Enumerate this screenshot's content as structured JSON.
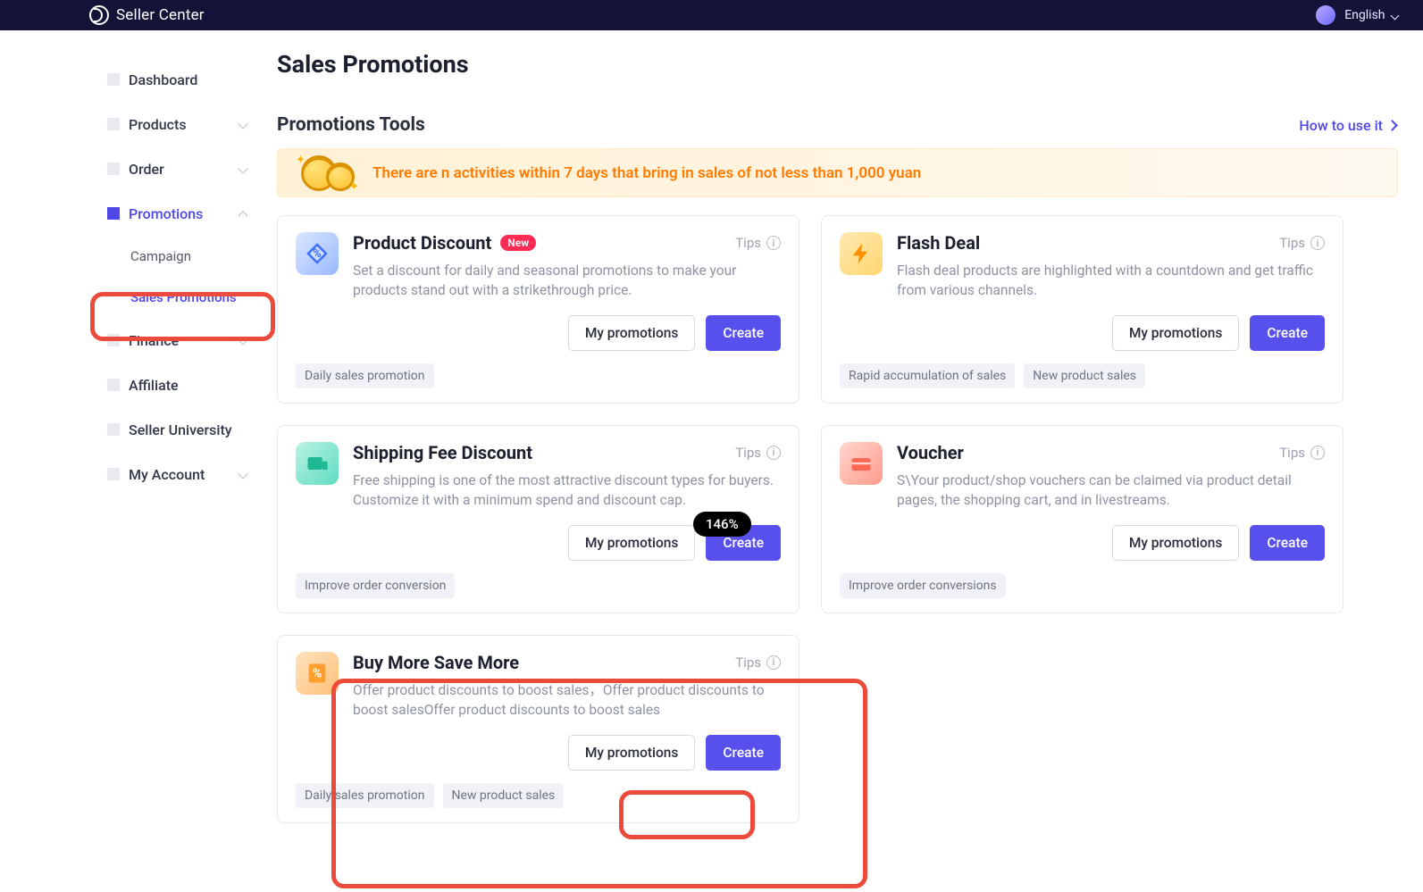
{
  "topbar": {
    "brand": "Seller Center",
    "language": "English"
  },
  "sidebar": {
    "items": [
      {
        "label": "Dashboard"
      },
      {
        "label": "Products"
      },
      {
        "label": "Order"
      },
      {
        "label": "Promotions"
      },
      {
        "label": "Finance"
      },
      {
        "label": "Affiliate"
      },
      {
        "label": "Seller University"
      },
      {
        "label": "My Account"
      }
    ],
    "sub_promo": {
      "campaign": "Campaign",
      "sales_promotions": "Sales Promotions"
    }
  },
  "page": {
    "title": "Sales Promotions",
    "section_title": "Promotions Tools",
    "how_to": "How to use it",
    "banner": "There are n activities within 7 days that bring in sales of not less than 1,000 yuan"
  },
  "cards": {
    "product_discount": {
      "title": "Product Discount",
      "badge": "New",
      "tips": "Tips",
      "desc": "Set a discount for daily and seasonal promotions to make your products stand out with a strikethrough price.",
      "my": "My promotions",
      "create": "Create",
      "chip1": "Daily sales promotion"
    },
    "flash_deal": {
      "title": "Flash Deal",
      "tips": "Tips",
      "desc": "Flash deal products are highlighted with a countdown and get traffic from various channels.",
      "my": "My promotions",
      "create": "Create",
      "chip1": "Rapid accumulation of sales",
      "chip2": "New product sales"
    },
    "shipping": {
      "title": "Shipping Fee Discount",
      "tips": "Tips",
      "desc": "Free shipping is one of the most attractive discount types for buyers. Customize it with a minimum spend and discount cap.",
      "my": "My promotions",
      "create": "Create",
      "chip1": "Improve order conversion"
    },
    "voucher": {
      "title": "Voucher",
      "tips": "Tips",
      "desc": "S\\Your product/shop vouchers can be claimed via product detail pages, the shopping cart, and in livestreams.",
      "my": "My promotions",
      "create": "Create",
      "chip1": "Improve order conversions"
    },
    "buy_more": {
      "title": "Buy More Save More",
      "tips": "Tips",
      "desc": "Offer product discounts to boost sales，Offer product discounts to boost salesOffer product discounts to boost sales",
      "my": "My promotions",
      "create": "Create",
      "chip1": "Daily sales promotion",
      "chip2": "New product sales"
    }
  },
  "zoom": "146%"
}
